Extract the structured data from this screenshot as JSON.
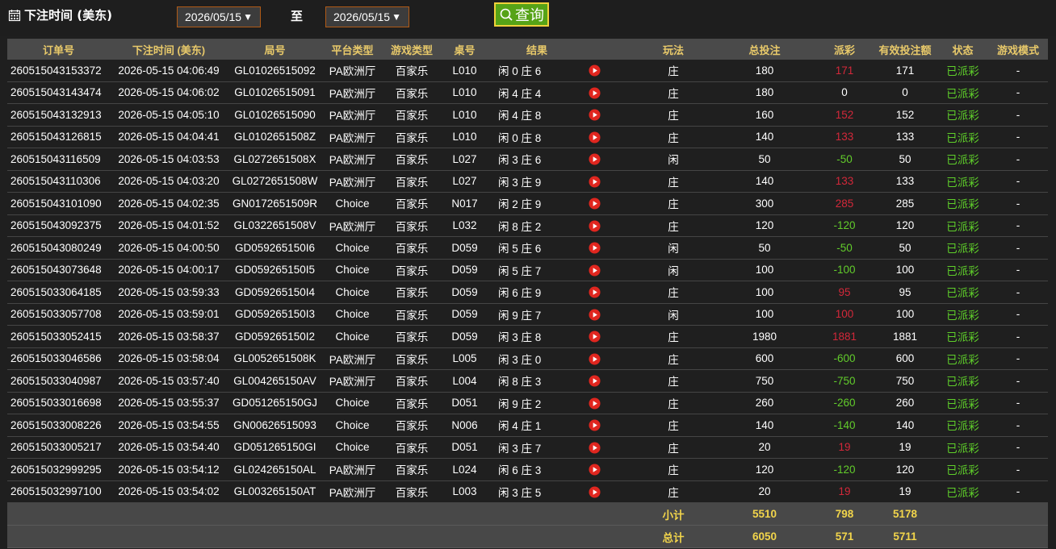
{
  "header": {
    "title": "下注时间 (美东)",
    "start_date": "2026/05/15",
    "to_label": "至",
    "end_date": "2026/05/15",
    "query_label": "查询",
    "dropdown_arrow": "▼"
  },
  "table": {
    "columns": [
      "订单号",
      "下注时间 (美东)",
      "局号",
      "平台类型",
      "游戏类型",
      "桌号",
      "结果",
      "",
      "玩法",
      "总投注",
      "派彩",
      "有效投注额",
      "状态",
      "游戏模式"
    ],
    "rows": [
      {
        "order": "260515043153372",
        "time": "2026-05-15 04:06:49",
        "round": "GL01026515092",
        "platform": "PA欧洲厅",
        "game": "百家乐",
        "table": "L010",
        "result": "闲 0 庄 6",
        "bet_on": "庄",
        "total": "180",
        "payout": "171",
        "payout_color": "red",
        "valid": "171",
        "status": "已派彩",
        "mode": "-"
      },
      {
        "order": "260515043143474",
        "time": "2026-05-15 04:06:02",
        "round": "GL01026515091",
        "platform": "PA欧洲厅",
        "game": "百家乐",
        "table": "L010",
        "result": "闲 4 庄 4",
        "bet_on": "庄",
        "total": "180",
        "payout": "0",
        "payout_color": "white",
        "valid": "0",
        "status": "已派彩",
        "mode": "-"
      },
      {
        "order": "260515043132913",
        "time": "2026-05-15 04:05:10",
        "round": "GL01026515090",
        "platform": "PA欧洲厅",
        "game": "百家乐",
        "table": "L010",
        "result": "闲 4 庄 8",
        "bet_on": "庄",
        "total": "160",
        "payout": "152",
        "payout_color": "red",
        "valid": "152",
        "status": "已派彩",
        "mode": "-"
      },
      {
        "order": "260515043126815",
        "time": "2026-05-15 04:04:41",
        "round": "GL0102651508Z",
        "platform": "PA欧洲厅",
        "game": "百家乐",
        "table": "L010",
        "result": "闲 0 庄 8",
        "bet_on": "庄",
        "total": "140",
        "payout": "133",
        "payout_color": "red",
        "valid": "133",
        "status": "已派彩",
        "mode": "-"
      },
      {
        "order": "260515043116509",
        "time": "2026-05-15 04:03:53",
        "round": "GL0272651508X",
        "platform": "PA欧洲厅",
        "game": "百家乐",
        "table": "L027",
        "result": "闲 3 庄 6",
        "bet_on": "闲",
        "total": "50",
        "payout": "-50",
        "payout_color": "green",
        "valid": "50",
        "status": "已派彩",
        "mode": "-"
      },
      {
        "order": "260515043110306",
        "time": "2026-05-15 04:03:20",
        "round": "GL0272651508W",
        "platform": "PA欧洲厅",
        "game": "百家乐",
        "table": "L027",
        "result": "闲 3 庄 9",
        "bet_on": "庄",
        "total": "140",
        "payout": "133",
        "payout_color": "red",
        "valid": "133",
        "status": "已派彩",
        "mode": "-"
      },
      {
        "order": "260515043101090",
        "time": "2026-05-15 04:02:35",
        "round": "GN0172651509R",
        "platform": "Choice",
        "game": "百家乐",
        "table": "N017",
        "result": "闲 2 庄 9",
        "bet_on": "庄",
        "total": "300",
        "payout": "285",
        "payout_color": "red",
        "valid": "285",
        "status": "已派彩",
        "mode": "-"
      },
      {
        "order": "260515043092375",
        "time": "2026-05-15 04:01:52",
        "round": "GL0322651508V",
        "platform": "PA欧洲厅",
        "game": "百家乐",
        "table": "L032",
        "result": "闲 8 庄 2",
        "bet_on": "庄",
        "total": "120",
        "payout": "-120",
        "payout_color": "green",
        "valid": "120",
        "status": "已派彩",
        "mode": "-"
      },
      {
        "order": "260515043080249",
        "time": "2026-05-15 04:00:50",
        "round": "GD059265150I6",
        "platform": "Choice",
        "game": "百家乐",
        "table": "D059",
        "result": "闲 5 庄 6",
        "bet_on": "闲",
        "total": "50",
        "payout": "-50",
        "payout_color": "green",
        "valid": "50",
        "status": "已派彩",
        "mode": "-"
      },
      {
        "order": "260515043073648",
        "time": "2026-05-15 04:00:17",
        "round": "GD059265150I5",
        "platform": "Choice",
        "game": "百家乐",
        "table": "D059",
        "result": "闲 5 庄 7",
        "bet_on": "闲",
        "total": "100",
        "payout": "-100",
        "payout_color": "green",
        "valid": "100",
        "status": "已派彩",
        "mode": "-"
      },
      {
        "order": "260515033064185",
        "time": "2026-05-15 03:59:33",
        "round": "GD059265150I4",
        "platform": "Choice",
        "game": "百家乐",
        "table": "D059",
        "result": "闲 6 庄 9",
        "bet_on": "庄",
        "total": "100",
        "payout": "95",
        "payout_color": "red",
        "valid": "95",
        "status": "已派彩",
        "mode": "-"
      },
      {
        "order": "260515033057708",
        "time": "2026-05-15 03:59:01",
        "round": "GD059265150I3",
        "platform": "Choice",
        "game": "百家乐",
        "table": "D059",
        "result": "闲 9 庄 7",
        "bet_on": "闲",
        "total": "100",
        "payout": "100",
        "payout_color": "red",
        "valid": "100",
        "status": "已派彩",
        "mode": "-"
      },
      {
        "order": "260515033052415",
        "time": "2026-05-15 03:58:37",
        "round": "GD059265150I2",
        "platform": "Choice",
        "game": "百家乐",
        "table": "D059",
        "result": "闲 3 庄 8",
        "bet_on": "庄",
        "total": "1980",
        "payout": "1881",
        "payout_color": "red",
        "valid": "1881",
        "status": "已派彩",
        "mode": "-"
      },
      {
        "order": "260515033046586",
        "time": "2026-05-15 03:58:04",
        "round": "GL0052651508K",
        "platform": "PA欧洲厅",
        "game": "百家乐",
        "table": "L005",
        "result": "闲 3 庄 0",
        "bet_on": "庄",
        "total": "600",
        "payout": "-600",
        "payout_color": "green",
        "valid": "600",
        "status": "已派彩",
        "mode": "-"
      },
      {
        "order": "260515033040987",
        "time": "2026-05-15 03:57:40",
        "round": "GL004265150AV",
        "platform": "PA欧洲厅",
        "game": "百家乐",
        "table": "L004",
        "result": "闲 8 庄 3",
        "bet_on": "庄",
        "total": "750",
        "payout": "-750",
        "payout_color": "green",
        "valid": "750",
        "status": "已派彩",
        "mode": "-"
      },
      {
        "order": "260515033016698",
        "time": "2026-05-15 03:55:37",
        "round": "GD051265150GJ",
        "platform": "Choice",
        "game": "百家乐",
        "table": "D051",
        "result": "闲 9 庄 2",
        "bet_on": "庄",
        "total": "260",
        "payout": "-260",
        "payout_color": "green",
        "valid": "260",
        "status": "已派彩",
        "mode": "-"
      },
      {
        "order": "260515033008226",
        "time": "2026-05-15 03:54:55",
        "round": "GN00626515093",
        "platform": "Choice",
        "game": "百家乐",
        "table": "N006",
        "result": "闲 4 庄 1",
        "bet_on": "庄",
        "total": "140",
        "payout": "-140",
        "payout_color": "green",
        "valid": "140",
        "status": "已派彩",
        "mode": "-"
      },
      {
        "order": "260515033005217",
        "time": "2026-05-15 03:54:40",
        "round": "GD051265150GI",
        "platform": "Choice",
        "game": "百家乐",
        "table": "D051",
        "result": "闲 3 庄 7",
        "bet_on": "庄",
        "total": "20",
        "payout": "19",
        "payout_color": "red",
        "valid": "19",
        "status": "已派彩",
        "mode": "-"
      },
      {
        "order": "260515032999295",
        "time": "2026-05-15 03:54:12",
        "round": "GL024265150AL",
        "platform": "PA欧洲厅",
        "game": "百家乐",
        "table": "L024",
        "result": "闲 6 庄 3",
        "bet_on": "庄",
        "total": "120",
        "payout": "-120",
        "payout_color": "green",
        "valid": "120",
        "status": "已派彩",
        "mode": "-"
      },
      {
        "order": "260515032997100",
        "time": "2026-05-15 03:54:02",
        "round": "GL003265150AT",
        "platform": "PA欧洲厅",
        "game": "百家乐",
        "table": "L003",
        "result": "闲 3 庄 5",
        "bet_on": "庄",
        "total": "20",
        "payout": "19",
        "payout_color": "red",
        "valid": "19",
        "status": "已派彩",
        "mode": "-"
      }
    ],
    "subtotal": {
      "label": "小计",
      "total": "5510",
      "payout": "798",
      "valid": "5178"
    },
    "grand_total": {
      "label": "总计",
      "total": "6050",
      "payout": "571",
      "valid": "5711"
    }
  },
  "colors": {
    "header_text": "#e8c96a",
    "payout_positive": "#d3283a",
    "payout_negative": "#62cc2b",
    "status": "#5fd02a",
    "sum_text": "#f2d54b",
    "query_button": "#56a317"
  },
  "icons": {
    "calendar": "calendar-icon",
    "search": "search-icon",
    "play": "play-icon"
  }
}
